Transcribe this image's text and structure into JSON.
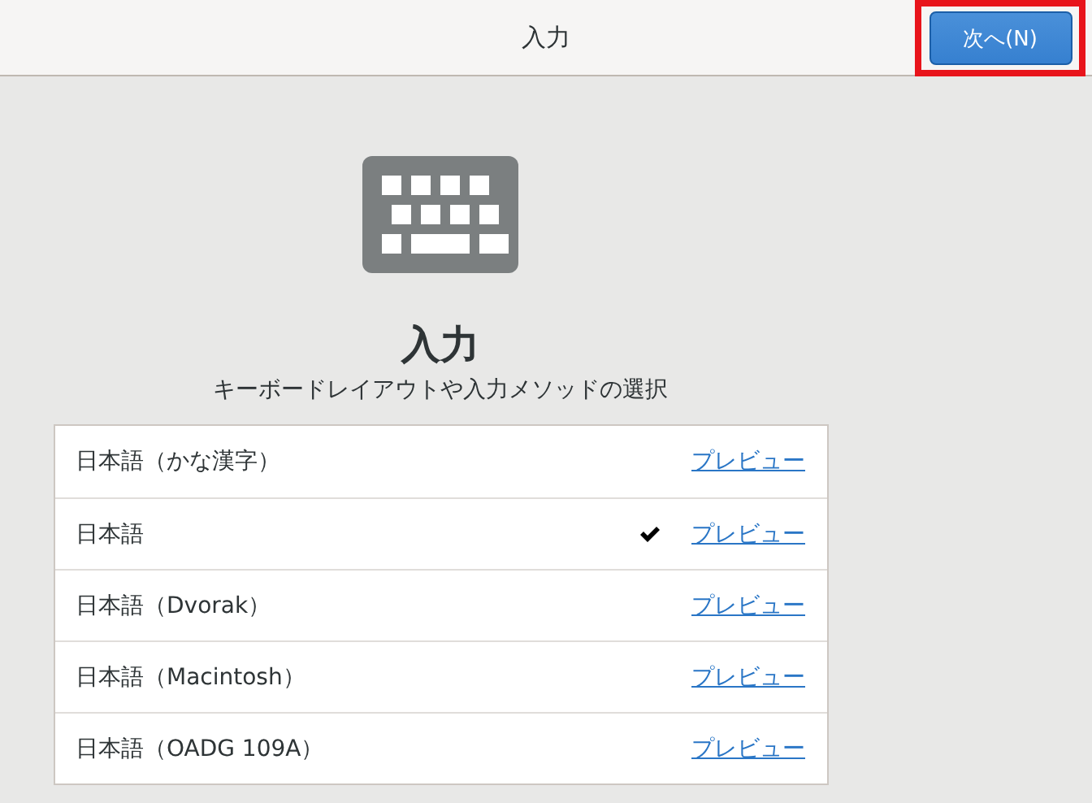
{
  "header": {
    "title": "入力",
    "next_button": {
      "label": "次へ(N)",
      "highlighted": true
    }
  },
  "heading": "入力",
  "subtitle": "キーボードレイアウトや入力メソッドの選択",
  "layouts": [
    {
      "name": "日本語（かな漢字）",
      "selected": false,
      "link": "プレビュー"
    },
    {
      "name": "日本語",
      "selected": true,
      "link": "プレビュー"
    },
    {
      "name": "日本語（Dvorak）",
      "selected": false,
      "link": "プレビュー"
    },
    {
      "name": "日本語（Macintosh）",
      "selected": false,
      "link": "プレビュー"
    },
    {
      "name": "日本語（OADG 109A）",
      "selected": false,
      "link": "プレビュー"
    }
  ]
}
